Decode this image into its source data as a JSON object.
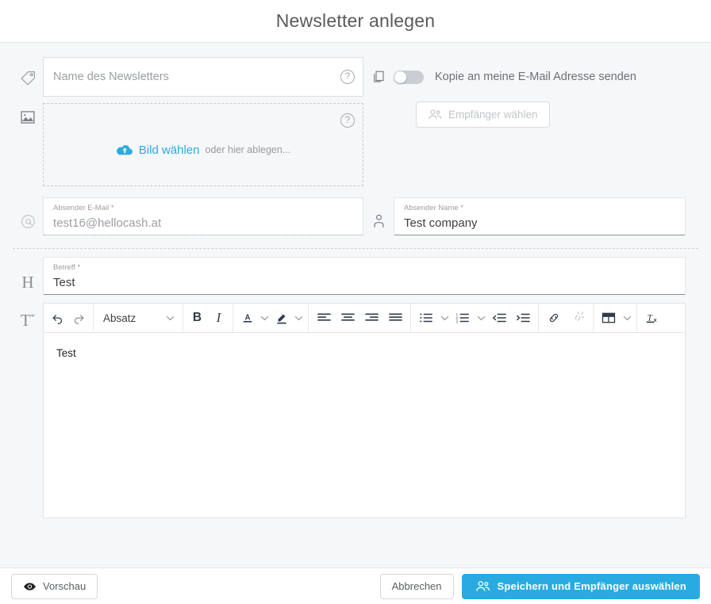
{
  "header": {
    "title": "Newsletter anlegen"
  },
  "fields": {
    "newsletter_name": {
      "icon": "tag-icon",
      "placeholder": "Name des Newsletters",
      "value": "",
      "help_glyph": "?"
    },
    "image": {
      "icon": "image-icon",
      "link_label": "Bild wählen",
      "hint": "oder hier ablegen...",
      "help_glyph": "?",
      "upload_icon": "cloud-upload-icon"
    },
    "sender_email": {
      "icon": "at-icon",
      "label": "Absender E-Mail *",
      "value": "test16@hellocash.at",
      "disabled": true
    },
    "sender_name": {
      "icon": "person-icon",
      "label": "Absender Name *",
      "value": "Test company",
      "disabled": false
    },
    "subject": {
      "icon": "H",
      "label": "Betreff *",
      "value": "Test"
    },
    "body": {
      "icon": "T",
      "icon_sup": "*",
      "value": "Test"
    }
  },
  "copy_option": {
    "icon": "copy-icon",
    "label": "Kopie an meine E-Mail Adresse senden",
    "toggle_state": "off"
  },
  "recipients_button": {
    "label": "Empfänger wählen",
    "icon": "people-icon",
    "disabled": true
  },
  "toolbar": {
    "undo": "↶",
    "redo": "↷",
    "paragraph_style": "Absatz",
    "bold": "B",
    "italic": "I",
    "text_color": "A",
    "highlight": "highlight-pen-icon",
    "align_left": "align-left-icon",
    "align_center": "align-center-icon",
    "align_right": "align-right-icon",
    "align_justify": "align-justify-icon",
    "bullet_list": "bullet-list-icon",
    "numbered_list": "numbered-list-icon",
    "outdent": "outdent-icon",
    "indent": "indent-icon",
    "link": "link-icon",
    "unlink": "unlink-icon",
    "table": "table-icon",
    "clear_format": "Tx",
    "chevron": "⌄"
  },
  "footer": {
    "preview_label": "Vorschau",
    "preview_icon": "eye-icon",
    "cancel_label": "Abbrechen",
    "submit_label": "Speichern und Empfänger auswählen",
    "submit_icon": "people-icon"
  },
  "colors": {
    "accent": "#29abe2",
    "page_bg": "#f6f7f9",
    "panel_bg": "#ffffff",
    "text": "#4a4a4a",
    "muted": "#9a9fa5"
  }
}
